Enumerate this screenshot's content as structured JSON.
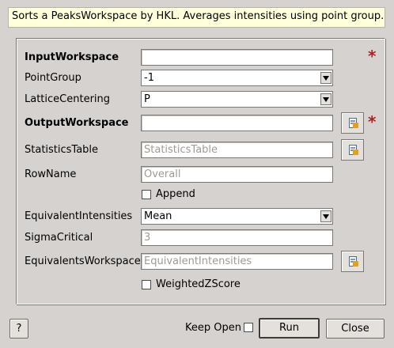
{
  "description": "Sorts a PeaksWorkspace by HKL. Averages intensities using point group.",
  "fields": {
    "input_workspace": {
      "label": "InputWorkspace",
      "value": "",
      "required_marker": "*"
    },
    "point_group": {
      "label": "PointGroup",
      "value": "-1"
    },
    "lattice_centering": {
      "label": "LatticeCentering",
      "value": "P"
    },
    "output_workspace": {
      "label": "OutputWorkspace",
      "value": "",
      "required_marker": "*"
    },
    "statistics_table": {
      "label": "StatisticsTable",
      "placeholder": "StatisticsTable"
    },
    "row_name": {
      "label": "RowName",
      "placeholder": "Overall"
    },
    "append": {
      "label": "Append",
      "checked": false
    },
    "equivalent_intensities": {
      "label": "EquivalentIntensities",
      "value": "Mean"
    },
    "sigma_critical": {
      "label": "SigmaCritical",
      "placeholder": "3"
    },
    "equivalents_workspace": {
      "label": "EquivalentsWorkspace",
      "placeholder": "EquivalentIntensities"
    },
    "weighted_z_score": {
      "label": "WeightedZScore",
      "checked": false
    }
  },
  "footer": {
    "help_label": "?",
    "keep_open_label": "Keep Open",
    "keep_open_checked": false,
    "run_label": "Run",
    "close_label": "Close"
  }
}
